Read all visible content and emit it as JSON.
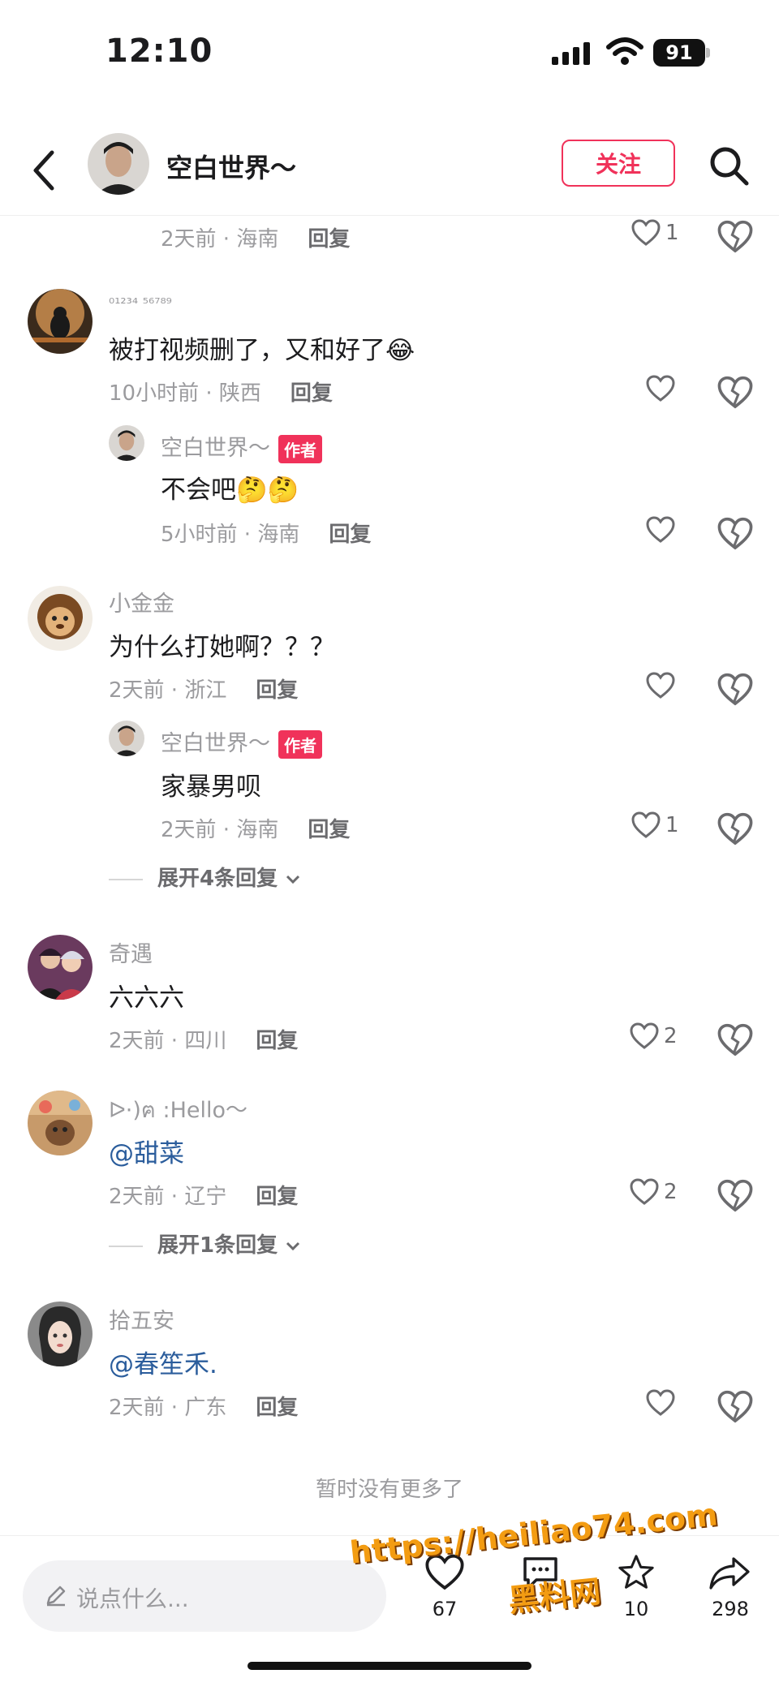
{
  "status_bar": {
    "time": "12:10",
    "battery": "91"
  },
  "header": {
    "title": "空白世界～",
    "follow_label": "关注"
  },
  "top_partial": {
    "meta_time": "2天前 · 海南",
    "reply_label": "回复",
    "likes": "1"
  },
  "comments": [
    {
      "username": "₀₁₂₃₄ ₅₆₇₈₉",
      "text": "被打视频删了，又和好了😂",
      "meta": "10小时前 · 陕西",
      "reply_label": "回复",
      "likes": "",
      "replies": [
        {
          "username": "空白世界～",
          "badge": "作者",
          "text": "不会吧🤔🤔",
          "meta": "5小时前 · 海南",
          "reply_label": "回复",
          "likes": ""
        }
      ]
    },
    {
      "username": "小金金",
      "text": "为什么打她啊？？？",
      "meta": "2天前 · 浙江",
      "reply_label": "回复",
      "likes": "",
      "replies": [
        {
          "username": "空白世界～",
          "badge": "作者",
          "text": "家暴男呗",
          "meta": "2天前 · 海南",
          "reply_label": "回复",
          "likes": "1"
        }
      ],
      "expand_label": "展开4条回复"
    },
    {
      "username": "奇遇",
      "text": "六六六",
      "meta": "2天前 · 四川",
      "reply_label": "回复",
      "likes": "2"
    },
    {
      "username": "ᐅ·)ฅ :Hello～",
      "text": "@甜菜",
      "meta": "2天前 · 辽宁",
      "reply_label": "回复",
      "likes": "2",
      "expand_label": "展开1条回复"
    },
    {
      "username": "拾五安",
      "text": "@春笙禾.",
      "meta": "2天前 · 广东",
      "reply_label": "回复",
      "likes": ""
    }
  ],
  "no_more": "暂时没有更多了",
  "bottom": {
    "input_placeholder": "说点什么...",
    "like_count": "67",
    "comment_count": "",
    "star_count": "10",
    "share_count": "298"
  },
  "watermark": {
    "line1": "https://heiliao74.com",
    "line2": "黑料网"
  },
  "colors": {
    "accent": "#f0325a",
    "mention": "#2b5d9c",
    "meta": "#9b9b9e"
  }
}
